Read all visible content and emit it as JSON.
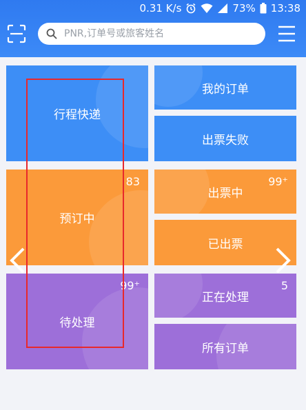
{
  "status_bar": {
    "speed": "0.31 K/s",
    "battery": "73%",
    "time": "13:38"
  },
  "search": {
    "placeholder": "PNR,订单号或旅客姓名"
  },
  "tiles": {
    "express": {
      "label": "行程快递"
    },
    "my_orders": {
      "label": "我的订单"
    },
    "failed": {
      "label": "出票失败"
    },
    "booking": {
      "label": "预订中",
      "count": "83"
    },
    "ticketing": {
      "label": "出票中",
      "count": "99⁺"
    },
    "ticketed": {
      "label": "已出票"
    },
    "pending": {
      "label": "待处理",
      "count": "99⁺"
    },
    "processing": {
      "label": "正在处理",
      "count": "5"
    },
    "all_orders": {
      "label": "所有订单"
    }
  },
  "colors": {
    "header": "#2f7af0",
    "blue": "#3d8ef6",
    "orange": "#fb9a3a",
    "purple": "#9d6fd9",
    "highlight": "#e8282b"
  },
  "icons": [
    "scan-icon",
    "search-icon",
    "menu-icon",
    "chevron-left-icon",
    "chevron-right-icon",
    "alarm-icon",
    "wifi-icon",
    "signal-icon",
    "battery-icon"
  ]
}
